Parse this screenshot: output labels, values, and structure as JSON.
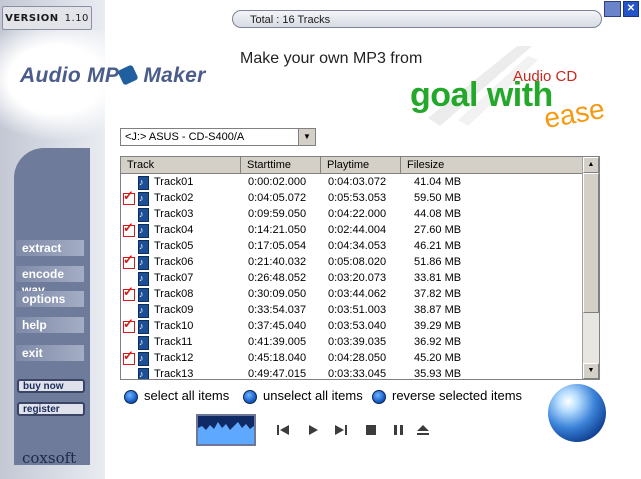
{
  "window": {
    "version_prefix": "VERSION",
    "version_number": "1.10",
    "status": "Total : 16 Tracks",
    "close_glyph": "✕"
  },
  "brand": {
    "logo_left": "Audio MP",
    "logo_right": "Maker",
    "tagline": "Make your own MP3 from",
    "slogan_1": "Audio CD",
    "slogan_2": "goal with",
    "slogan_3": "ease",
    "company": "coxsoft"
  },
  "drive": {
    "selected": "<J:> ASUS - CD-S400/A"
  },
  "table": {
    "columns": [
      "Track",
      "Starttime",
      "Playtime",
      "Filesize"
    ],
    "rows": [
      {
        "checked": false,
        "track": "Track01",
        "start": "0:00:02.000",
        "play": "0:04:03.072",
        "size": "41.04 MB"
      },
      {
        "checked": true,
        "track": "Track02",
        "start": "0:04:05.072",
        "play": "0:05:53.053",
        "size": "59.50 MB"
      },
      {
        "checked": false,
        "track": "Track03",
        "start": "0:09:59.050",
        "play": "0:04:22.000",
        "size": "44.08 MB"
      },
      {
        "checked": true,
        "track": "Track04",
        "start": "0:14:21.050",
        "play": "0:02:44.004",
        "size": "27.60 MB"
      },
      {
        "checked": false,
        "track": "Track05",
        "start": "0:17:05.054",
        "play": "0:04:34.053",
        "size": "46.21 MB"
      },
      {
        "checked": true,
        "track": "Track06",
        "start": "0:21:40.032",
        "play": "0:05:08.020",
        "size": "51.86 MB"
      },
      {
        "checked": false,
        "track": "Track07",
        "start": "0:26:48.052",
        "play": "0:03:20.073",
        "size": "33.81 MB"
      },
      {
        "checked": true,
        "track": "Track08",
        "start": "0:30:09.050",
        "play": "0:03:44.062",
        "size": "37.82 MB"
      },
      {
        "checked": false,
        "track": "Track09",
        "start": "0:33:54.037",
        "play": "0:03:51.003",
        "size": "38.87 MB"
      },
      {
        "checked": true,
        "track": "Track10",
        "start": "0:37:45.040",
        "play": "0:03:53.040",
        "size": "39.29 MB"
      },
      {
        "checked": false,
        "track": "Track11",
        "start": "0:41:39.005",
        "play": "0:03:39.035",
        "size": "36.92 MB"
      },
      {
        "checked": true,
        "track": "Track12",
        "start": "0:45:18.040",
        "play": "0:04:28.050",
        "size": "45.20 MB"
      },
      {
        "checked": false,
        "track": "Track13",
        "start": "0:49:47.015",
        "play": "0:03:33.045",
        "size": "35.93 MB"
      }
    ]
  },
  "menu": {
    "extract": "extract",
    "encode_wav": "encode wav",
    "options": "options",
    "help": "help",
    "exit": "exit",
    "buy_now": "buy now",
    "register": "register"
  },
  "selection": {
    "select_all": "select all items",
    "unselect_all": "unselect all items",
    "reverse": "reverse selected items"
  },
  "player": {
    "prev_icon": "skip-back-icon",
    "play_icon": "play-icon",
    "next_icon": "skip-forward-icon",
    "stop_icon": "stop-icon",
    "pause_icon": "pause-icon",
    "eject_icon": "eject-icon"
  },
  "colors": {
    "accent": "#6f7b9a",
    "slogan_green": "#23a82a",
    "slogan_red": "#c8281e",
    "slogan_orange": "#f59a12",
    "check_red": "#d81a1a"
  }
}
